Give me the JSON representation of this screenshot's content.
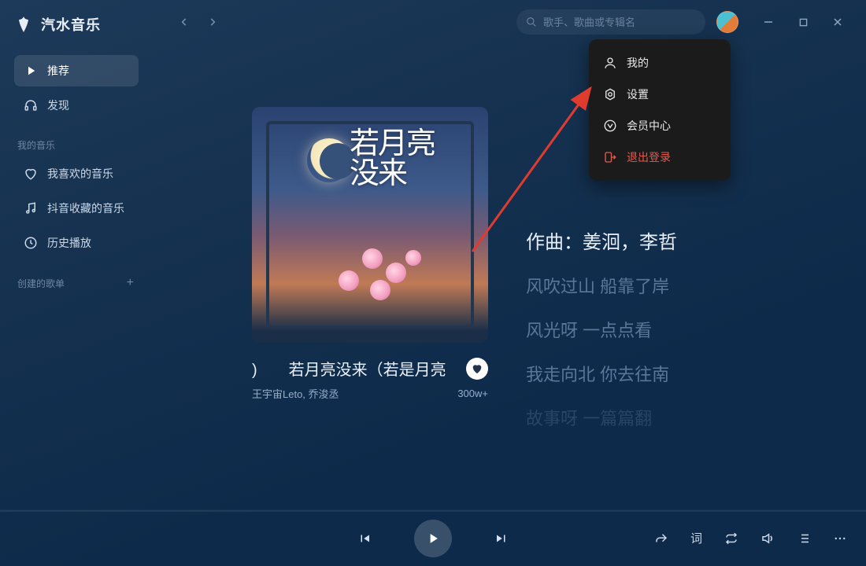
{
  "app": {
    "name": "汽水音乐"
  },
  "search": {
    "placeholder": "歌手、歌曲或专辑名"
  },
  "sidebar": {
    "items": [
      {
        "icon": "play",
        "label": "推荐",
        "active": true
      },
      {
        "icon": "headphones",
        "label": "发现",
        "active": false
      }
    ],
    "section_my_music": "我的音乐",
    "my_items": [
      {
        "icon": "heart",
        "label": "我喜欢的音乐"
      },
      {
        "icon": "douyin",
        "label": "抖音收藏的音乐"
      },
      {
        "icon": "history",
        "label": "历史播放"
      }
    ],
    "section_playlists": "创建的歌单"
  },
  "user_menu": {
    "items": [
      {
        "key": "mine",
        "label": "我的"
      },
      {
        "key": "settings",
        "label": "设置"
      },
      {
        "key": "vip",
        "label": "会员中心"
      },
      {
        "key": "logout",
        "label": "退出登录"
      }
    ]
  },
  "now_playing": {
    "cover_title": "若月亮没来",
    "title": ")　　若月亮没来（若是月亮",
    "artist": "王宇宙Leto, 乔浚丞",
    "likes": "300w+"
  },
  "lyrics": {
    "lines": [
      {
        "text": "作曲：姜洄，李哲",
        "active": true
      },
      {
        "text": "风吹过山 船靠了岸",
        "active": false
      },
      {
        "text": "风光呀 一点点看",
        "active": false
      },
      {
        "text": "我走向北 你去往南",
        "active": false
      },
      {
        "text": "故事呀 一篇篇翻",
        "active": false,
        "fade": true
      }
    ]
  },
  "player": {
    "lyric_btn": "词"
  }
}
